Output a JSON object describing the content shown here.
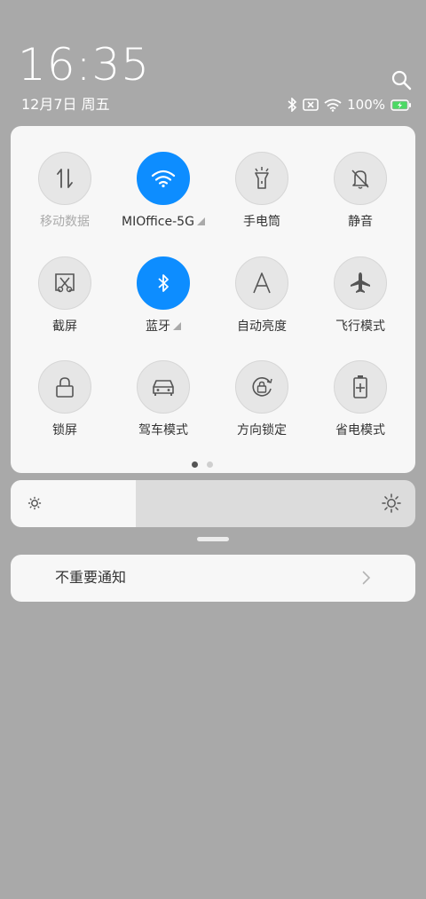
{
  "status": {
    "time": "16:35",
    "date": "12月7日 周五",
    "battery_percent": "100%",
    "battery_level": 1.0,
    "icons": [
      "bluetooth-icon",
      "no-sim-icon",
      "wifi-icon",
      "battery-charging-icon"
    ]
  },
  "header": {
    "search_icon": "search-icon"
  },
  "quick_tiles": [
    {
      "label": "移动数据",
      "icon": "mobile-data-icon",
      "active": false,
      "dimmed": true
    },
    {
      "label": "MIOffice-5G",
      "icon": "wifi-icon",
      "active": true,
      "expandable": true
    },
    {
      "label": "手电筒",
      "icon": "flashlight-icon",
      "active": false
    },
    {
      "label": "静音",
      "icon": "silent-bell-icon",
      "active": false
    },
    {
      "label": "截屏",
      "icon": "screenshot-icon",
      "active": false
    },
    {
      "label": "蓝牙",
      "icon": "bluetooth-icon",
      "active": true,
      "expandable": true
    },
    {
      "label": "自动亮度",
      "icon": "auto-brightness-icon",
      "active": false
    },
    {
      "label": "飞行模式",
      "icon": "airplane-icon",
      "active": false
    },
    {
      "label": "锁屏",
      "icon": "lock-icon",
      "active": false
    },
    {
      "label": "驾车模式",
      "icon": "car-icon",
      "active": false
    },
    {
      "label": "方向锁定",
      "icon": "rotation-lock-icon",
      "active": false
    },
    {
      "label": "省电模式",
      "icon": "battery-saver-icon",
      "active": false
    }
  ],
  "pager": {
    "pages": 2,
    "current": 1
  },
  "brightness": {
    "level": 0.31
  },
  "notifications": {
    "unimportant_label": "不重要通知"
  },
  "colors": {
    "accent": "#0d8dff",
    "background": "#a9a9a9",
    "panel": "#f7f7f7",
    "battery_green": "#4cd964"
  }
}
